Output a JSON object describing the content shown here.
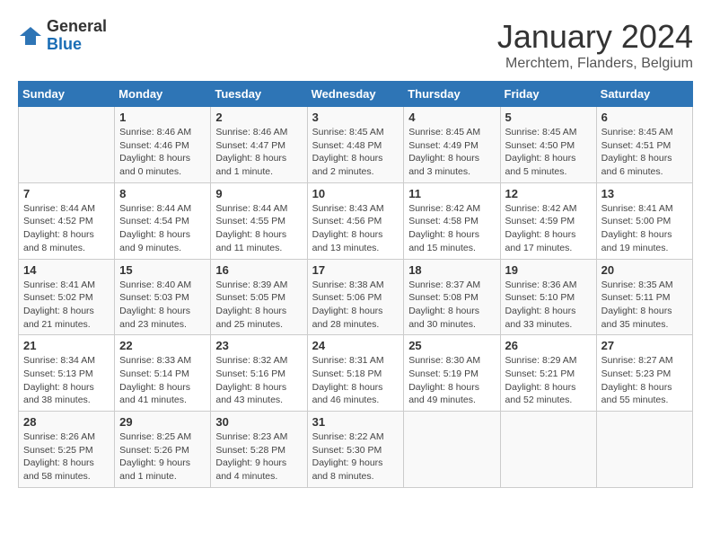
{
  "logo": {
    "general": "General",
    "blue": "Blue"
  },
  "title": "January 2024",
  "subtitle": "Merchtem, Flanders, Belgium",
  "days_header": [
    "Sunday",
    "Monday",
    "Tuesday",
    "Wednesday",
    "Thursday",
    "Friday",
    "Saturday"
  ],
  "weeks": [
    [
      {
        "day": "",
        "info": ""
      },
      {
        "day": "1",
        "info": "Sunrise: 8:46 AM\nSunset: 4:46 PM\nDaylight: 8 hours\nand 0 minutes."
      },
      {
        "day": "2",
        "info": "Sunrise: 8:46 AM\nSunset: 4:47 PM\nDaylight: 8 hours\nand 1 minute."
      },
      {
        "day": "3",
        "info": "Sunrise: 8:45 AM\nSunset: 4:48 PM\nDaylight: 8 hours\nand 2 minutes."
      },
      {
        "day": "4",
        "info": "Sunrise: 8:45 AM\nSunset: 4:49 PM\nDaylight: 8 hours\nand 3 minutes."
      },
      {
        "day": "5",
        "info": "Sunrise: 8:45 AM\nSunset: 4:50 PM\nDaylight: 8 hours\nand 5 minutes."
      },
      {
        "day": "6",
        "info": "Sunrise: 8:45 AM\nSunset: 4:51 PM\nDaylight: 8 hours\nand 6 minutes."
      }
    ],
    [
      {
        "day": "7",
        "info": "Sunrise: 8:44 AM\nSunset: 4:52 PM\nDaylight: 8 hours\nand 8 minutes."
      },
      {
        "day": "8",
        "info": "Sunrise: 8:44 AM\nSunset: 4:54 PM\nDaylight: 8 hours\nand 9 minutes."
      },
      {
        "day": "9",
        "info": "Sunrise: 8:44 AM\nSunset: 4:55 PM\nDaylight: 8 hours\nand 11 minutes."
      },
      {
        "day": "10",
        "info": "Sunrise: 8:43 AM\nSunset: 4:56 PM\nDaylight: 8 hours\nand 13 minutes."
      },
      {
        "day": "11",
        "info": "Sunrise: 8:42 AM\nSunset: 4:58 PM\nDaylight: 8 hours\nand 15 minutes."
      },
      {
        "day": "12",
        "info": "Sunrise: 8:42 AM\nSunset: 4:59 PM\nDaylight: 8 hours\nand 17 minutes."
      },
      {
        "day": "13",
        "info": "Sunrise: 8:41 AM\nSunset: 5:00 PM\nDaylight: 8 hours\nand 19 minutes."
      }
    ],
    [
      {
        "day": "14",
        "info": "Sunrise: 8:41 AM\nSunset: 5:02 PM\nDaylight: 8 hours\nand 21 minutes."
      },
      {
        "day": "15",
        "info": "Sunrise: 8:40 AM\nSunset: 5:03 PM\nDaylight: 8 hours\nand 23 minutes."
      },
      {
        "day": "16",
        "info": "Sunrise: 8:39 AM\nSunset: 5:05 PM\nDaylight: 8 hours\nand 25 minutes."
      },
      {
        "day": "17",
        "info": "Sunrise: 8:38 AM\nSunset: 5:06 PM\nDaylight: 8 hours\nand 28 minutes."
      },
      {
        "day": "18",
        "info": "Sunrise: 8:37 AM\nSunset: 5:08 PM\nDaylight: 8 hours\nand 30 minutes."
      },
      {
        "day": "19",
        "info": "Sunrise: 8:36 AM\nSunset: 5:10 PM\nDaylight: 8 hours\nand 33 minutes."
      },
      {
        "day": "20",
        "info": "Sunrise: 8:35 AM\nSunset: 5:11 PM\nDaylight: 8 hours\nand 35 minutes."
      }
    ],
    [
      {
        "day": "21",
        "info": "Sunrise: 8:34 AM\nSunset: 5:13 PM\nDaylight: 8 hours\nand 38 minutes."
      },
      {
        "day": "22",
        "info": "Sunrise: 8:33 AM\nSunset: 5:14 PM\nDaylight: 8 hours\nand 41 minutes."
      },
      {
        "day": "23",
        "info": "Sunrise: 8:32 AM\nSunset: 5:16 PM\nDaylight: 8 hours\nand 43 minutes."
      },
      {
        "day": "24",
        "info": "Sunrise: 8:31 AM\nSunset: 5:18 PM\nDaylight: 8 hours\nand 46 minutes."
      },
      {
        "day": "25",
        "info": "Sunrise: 8:30 AM\nSunset: 5:19 PM\nDaylight: 8 hours\nand 49 minutes."
      },
      {
        "day": "26",
        "info": "Sunrise: 8:29 AM\nSunset: 5:21 PM\nDaylight: 8 hours\nand 52 minutes."
      },
      {
        "day": "27",
        "info": "Sunrise: 8:27 AM\nSunset: 5:23 PM\nDaylight: 8 hours\nand 55 minutes."
      }
    ],
    [
      {
        "day": "28",
        "info": "Sunrise: 8:26 AM\nSunset: 5:25 PM\nDaylight: 8 hours\nand 58 minutes."
      },
      {
        "day": "29",
        "info": "Sunrise: 8:25 AM\nSunset: 5:26 PM\nDaylight: 9 hours\nand 1 minute."
      },
      {
        "day": "30",
        "info": "Sunrise: 8:23 AM\nSunset: 5:28 PM\nDaylight: 9 hours\nand 4 minutes."
      },
      {
        "day": "31",
        "info": "Sunrise: 8:22 AM\nSunset: 5:30 PM\nDaylight: 9 hours\nand 8 minutes."
      },
      {
        "day": "",
        "info": ""
      },
      {
        "day": "",
        "info": ""
      },
      {
        "day": "",
        "info": ""
      }
    ]
  ]
}
